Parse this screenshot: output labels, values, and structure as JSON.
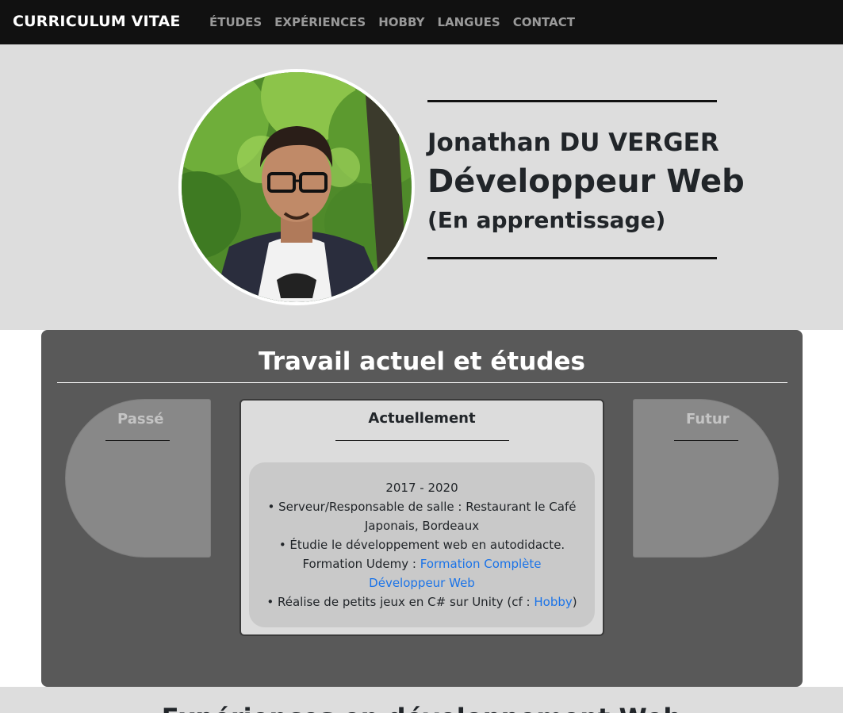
{
  "navbar": {
    "brand": "CURRICULUM VITAE",
    "links": [
      "ÉTUDES",
      "EXPÉRIENCES",
      "HOBBY",
      "LANGUES",
      "CONTACT"
    ]
  },
  "hero": {
    "name": "Jonathan DU VERGER",
    "job": "Développeur Web",
    "subtitle": "(En apprentissage)"
  },
  "section": {
    "title": "Travail actuel et études",
    "past_label": "Passé",
    "future_label": "Futur",
    "current": {
      "title": "Actuellement",
      "years": "2017 - 2020",
      "line1": "• Serveur/Responsable de salle : Restaurant le Café Japonais, Bordeaux",
      "line2": "• Étudie le développement web en autodidacte.",
      "line3_prefix": "Formation Udemy : ",
      "line3_link": "Formation Complète Développeur Web",
      "line4_prefix": "• Réalise de petits jeux en C# sur Unity (cf : ",
      "line4_link": "Hobby",
      "line4_suffix": ")"
    }
  },
  "next_section": {
    "title": "Expériences en développement Web"
  },
  "colors": {
    "navbar_bg": "#111111",
    "hero_bg": "#dddddd",
    "section_bg": "#595959",
    "side_card_bg": "#888888",
    "current_card_bg": "#dcdcdc",
    "inner_box_bg": "#c9c9c9",
    "link": "#1a73e8"
  }
}
